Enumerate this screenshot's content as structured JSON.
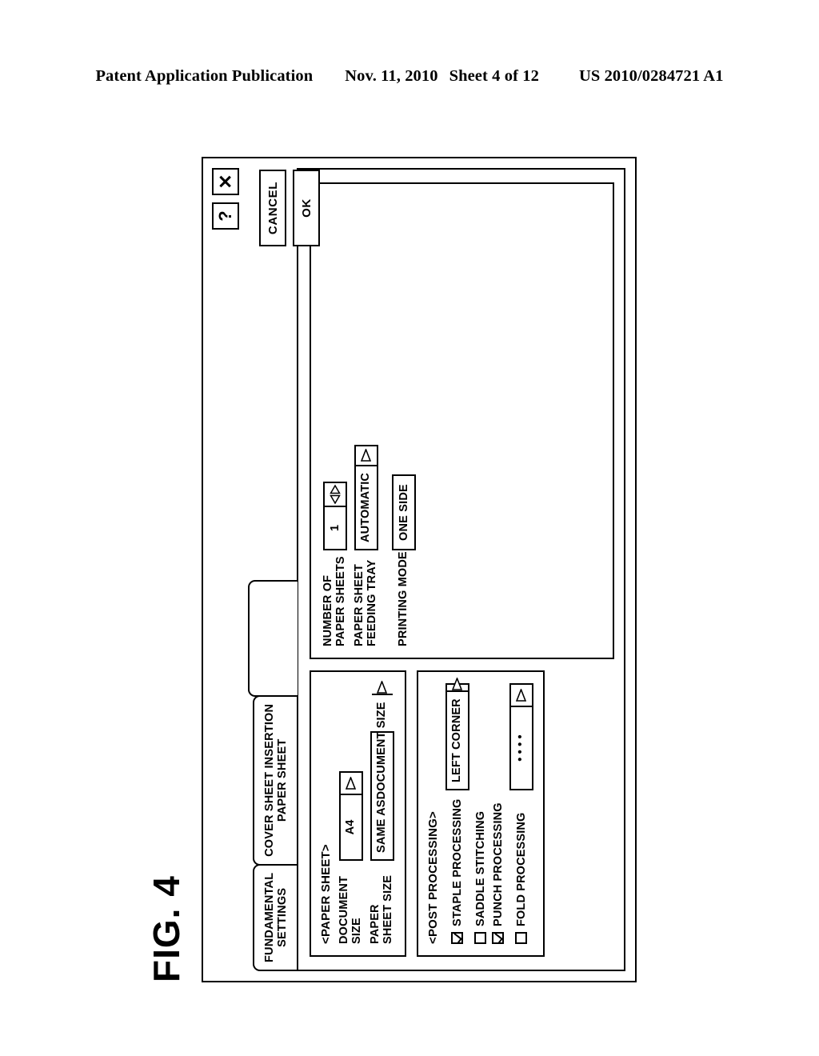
{
  "patent_header": {
    "publication": "Patent Application Publication",
    "date": "Nov. 11, 2010",
    "sheet": "Sheet 4 of 12",
    "number": "US 2010/0284721 A1"
  },
  "figure": {
    "label": "FIG. 4"
  },
  "dialog": {
    "titlebar": {
      "help_label": "?",
      "close_label": "✕"
    },
    "tabs": [
      {
        "line1": "FUNDAMENTAL",
        "line2": "SETTINGS",
        "active": false
      },
      {
        "line1": "COVER SHEET INSERTION",
        "line2": "PAPER SHEET",
        "active": false
      },
      {
        "line1": "",
        "line2": "",
        "active": true
      }
    ],
    "paper_sheet_group": {
      "title": "<PAPER SHEET>",
      "fields": [
        {
          "label_line1": "DOCUMENT",
          "label_line2": "SIZE",
          "value_line1": "A4",
          "value_line2": "",
          "control": "dropdown"
        },
        {
          "label_line1": "PAPER",
          "label_line2": "SHEET SIZE",
          "value_line1": "SAME AS",
          "value_line2": "DOCUMENT SIZE",
          "control": "dropdown"
        }
      ]
    },
    "post_processing_group": {
      "title": "<POST PROCESSING>",
      "items": [
        {
          "label": "STAPLE PROCESSING",
          "checked": true,
          "control": "dropdown",
          "value": "LEFT CORNER"
        },
        {
          "label": "SADDLE STITCHING",
          "checked": false,
          "control": "none",
          "value": ""
        },
        {
          "label": "PUNCH PROCESSING",
          "checked": true,
          "control": "none",
          "value": ""
        },
        {
          "label": "FOLD PROCESSING",
          "checked": false,
          "control": "dropdown",
          "value": "• • • •"
        }
      ]
    },
    "settings_group": {
      "fields": [
        {
          "label_line1": "NUMBER OF",
          "label_line2": "PAPER SHEETS",
          "value": "1",
          "control": "spinner"
        },
        {
          "label_line1": "PAPER SHEET",
          "label_line2": "FEEDING TRAY",
          "value": "AUTOMATIC",
          "control": "dropdown"
        },
        {
          "label_line1": "PRINTING MODE",
          "label_line2": "",
          "value": "ONE SIDE",
          "control": "button"
        }
      ]
    },
    "actions": {
      "cancel_label": "CANCEL",
      "ok_label": "OK"
    }
  }
}
